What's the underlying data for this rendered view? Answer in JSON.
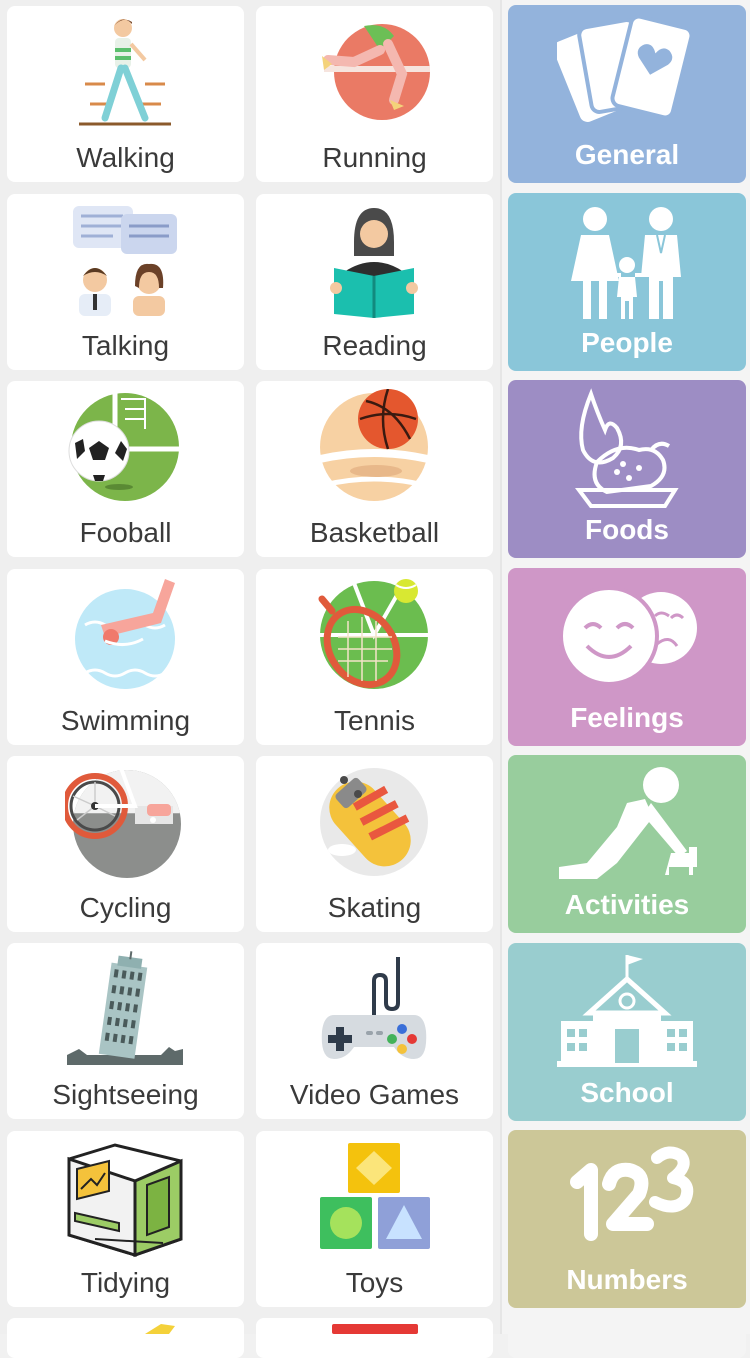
{
  "activities": [
    {
      "label": "Walking",
      "icon": "walking-icon"
    },
    {
      "label": "Running",
      "icon": "running-icon"
    },
    {
      "label": "Talking",
      "icon": "talking-icon"
    },
    {
      "label": "Reading",
      "icon": "reading-icon"
    },
    {
      "label": "Fooball",
      "icon": "football-icon"
    },
    {
      "label": "Basketball",
      "icon": "basketball-icon"
    },
    {
      "label": "Swimming",
      "icon": "swimming-icon"
    },
    {
      "label": "Tennis",
      "icon": "tennis-icon"
    },
    {
      "label": "Cycling",
      "icon": "cycling-icon"
    },
    {
      "label": "Skating",
      "icon": "skating-icon"
    },
    {
      "label": "Sightseeing",
      "icon": "sightseeing-icon"
    },
    {
      "label": "Video Games",
      "icon": "video-games-icon"
    },
    {
      "label": "Tidying",
      "icon": "tidying-icon"
    },
    {
      "label": "Toys",
      "icon": "toys-icon"
    }
  ],
  "categories": [
    {
      "label": "General",
      "icon": "cards-icon",
      "color": "#93b3dc"
    },
    {
      "label": "People",
      "icon": "family-icon",
      "color": "#8ac6d9"
    },
    {
      "label": "Foods",
      "icon": "foods-icon",
      "color": "#9d8dc4"
    },
    {
      "label": "Feelings",
      "icon": "feelings-icon",
      "color": "#cf97c7"
    },
    {
      "label": "Activities",
      "icon": "activities-icon",
      "color": "#98cd9d"
    },
    {
      "label": "School",
      "icon": "school-icon",
      "color": "#99cdcf"
    },
    {
      "label": "Numbers",
      "icon": "numbers-icon",
      "color": "#ccc798"
    }
  ]
}
